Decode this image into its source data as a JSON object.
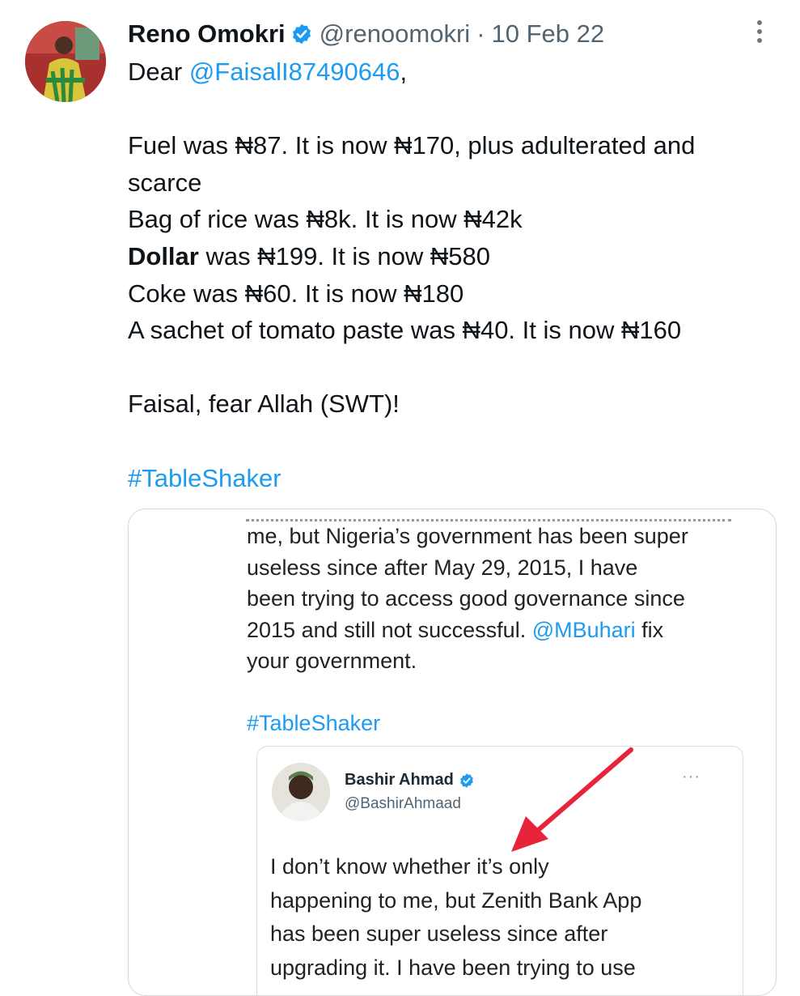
{
  "tweet": {
    "author_name": "Reno Omokri",
    "handle": "@renoomokri",
    "separator": "·",
    "date": "10 Feb 22",
    "greeting_prefix": "Dear ",
    "mention": "@FaisalI87490646",
    "greeting_suffix": ",",
    "lines": {
      "fuel_1": "Fuel was ₦87. It is now ₦170, plus adulterated and",
      "fuel_2": "scarce",
      "rice": "Bag of rice was ₦8k. It is now ₦42k",
      "dollar_bold": "Dollar",
      "dollar_rest": " was ₦199. It is now ₦580",
      "coke": "Coke was ₦60. It is now ₦180",
      "tomato": "A sachet of tomato paste was ₦40. It is now ₦160",
      "closing": "Faisal, fear Allah (SWT)!",
      "hashtag": "#TableShaker"
    }
  },
  "quoted": {
    "lines": {
      "l1": "me, but Nigeria’s government has been super",
      "l2": "useless since after May 29, 2015, I have",
      "l3": "been trying to access good governance since",
      "l4_pre": "2015 and still not successful. ",
      "l4_mention": "@MBuhari",
      "l4_post": " fix",
      "l5": "your government.",
      "hashtag": "#TableShaker"
    },
    "inner": {
      "name": "Bashir Ahmad",
      "handle": "@BashirAhmaad",
      "more": "···",
      "lines": {
        "l1": "I don’t know whether it’s only",
        "l2": "happening to me, but Zenith Bank App",
        "l3": "has been super useless since after",
        "l4": "upgrading it. I have been trying to use"
      }
    }
  },
  "colors": {
    "link": "#1d9bf0",
    "verified": "#1d9bf0",
    "arrow": "#e8243a"
  },
  "icons": [
    "verified-badge-icon",
    "more-options-icon",
    "red-arrow-annotation"
  ]
}
